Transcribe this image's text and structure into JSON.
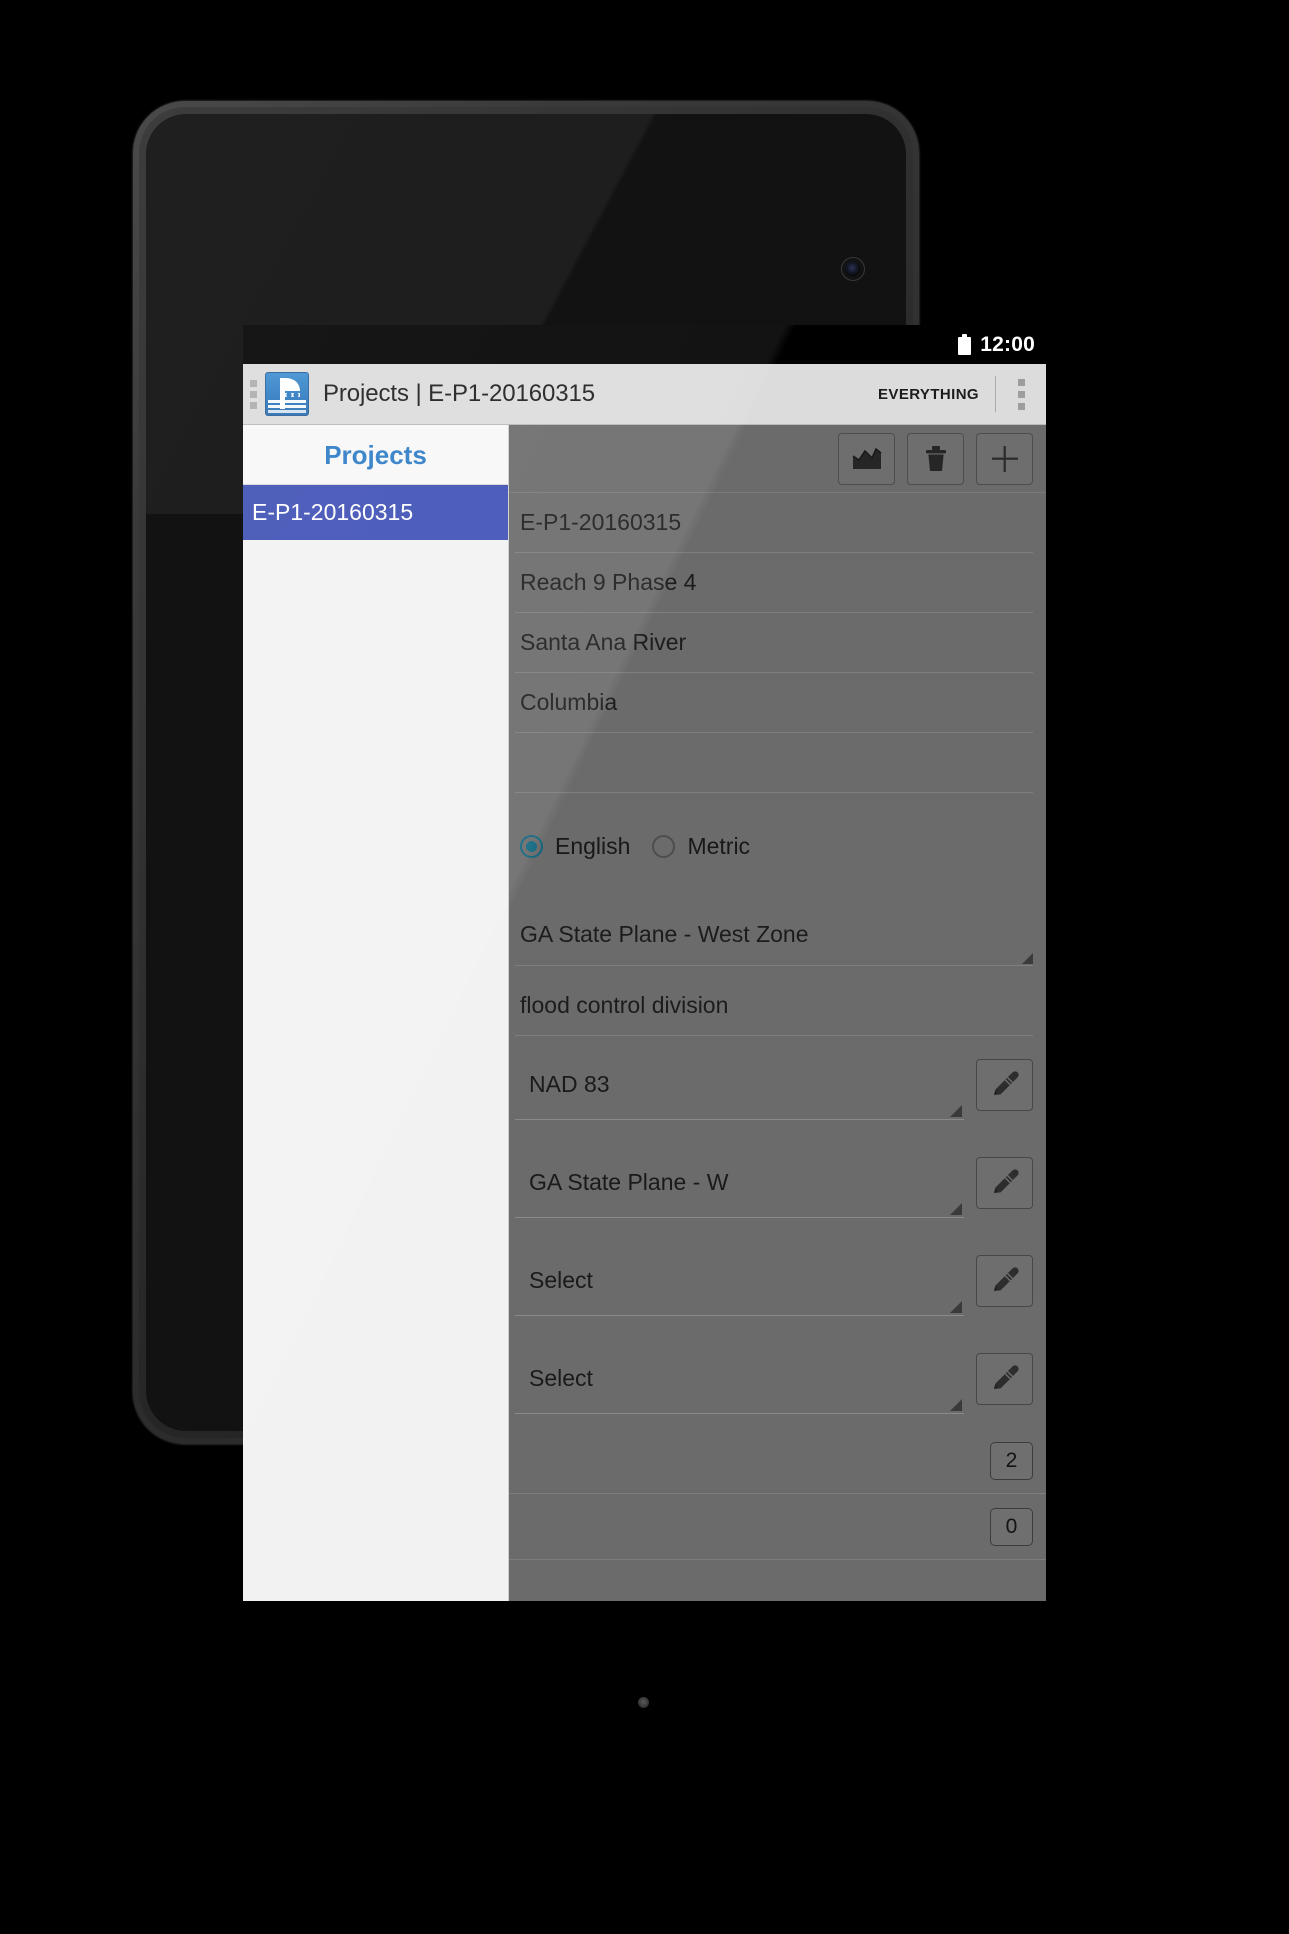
{
  "status_bar": {
    "time": "12:00",
    "battery_icon": "battery-full-icon"
  },
  "app_bar": {
    "app_icon": "levee-profile-app-icon",
    "title": "Projects | E-P1-20160315",
    "action_label": "EVERYTHING",
    "overflow_icon": "overflow-menu-icon",
    "drawer_icon": "drawer-handle-icon"
  },
  "sidebar": {
    "title": "Projects",
    "items": [
      {
        "label": "E-P1-20160315",
        "selected": true
      }
    ]
  },
  "detail": {
    "toolbar": [
      {
        "name": "chart-icon",
        "label": "chart"
      },
      {
        "name": "trash-icon",
        "label": "delete"
      },
      {
        "name": "plus-icon",
        "label": "add"
      }
    ],
    "fields": [
      {
        "key": "project_id",
        "value": "E-P1-20160315"
      },
      {
        "key": "reach",
        "value": "Reach 9 Phase 4"
      },
      {
        "key": "river",
        "value": "Santa Ana River"
      },
      {
        "key": "district",
        "value": "Columbia"
      },
      {
        "key": "blank",
        "value": ""
      }
    ],
    "units": {
      "options": [
        {
          "label": "English",
          "selected": true
        },
        {
          "label": "Metric",
          "selected": false
        }
      ]
    },
    "coordinate_system_note": "GA State Plane - West Zone",
    "division": "flood control division",
    "spinners": [
      {
        "key": "datum",
        "value": "NAD 83",
        "edit_icon": "pencil-icon"
      },
      {
        "key": "projection",
        "value": "GA State Plane - W",
        "edit_icon": "pencil-icon"
      },
      {
        "key": "vertical_datum",
        "value": "Select",
        "edit_icon": "pencil-icon"
      },
      {
        "key": "units_system",
        "value": "Select",
        "edit_icon": "pencil-icon"
      }
    ],
    "counters": [
      {
        "key": "count_a",
        "value": "2"
      },
      {
        "key": "count_b",
        "value": "0"
      }
    ]
  },
  "colors": {
    "accent_blue": "#2e7cc6",
    "selected_item": "#3f51b5",
    "radio_on": "#10677f",
    "app_bar_bg": "#dcdcdc",
    "detail_bg": "#6b6b6b",
    "sidebar_bg": "#f2f2f2"
  }
}
